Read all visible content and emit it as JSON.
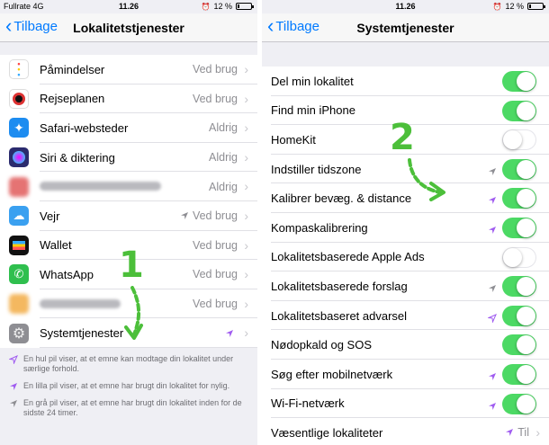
{
  "left": {
    "status": {
      "carrier": "Fullrate 4G",
      "time": "11.26",
      "battery": "12 %",
      "battery_level": 0.12
    },
    "nav": {
      "back": "Tilbage",
      "title": "Lokalitetstjenester"
    },
    "rows": [
      {
        "name": "reminders",
        "label": "Påmindelser",
        "value": "Ved brug",
        "icon": "reminders-icon",
        "color": "#ffffff"
      },
      {
        "name": "journey",
        "label": "Rejseplanen",
        "value": "Ved brug",
        "icon": "journey-planner-icon",
        "color": "#ffffff"
      },
      {
        "name": "safari",
        "label": "Safari-websteder",
        "value": "Aldrig",
        "icon": "safari-compass-icon",
        "color": "#1d8cf0"
      },
      {
        "name": "siri",
        "label": "Siri & diktering",
        "value": "Aldrig",
        "icon": "siri-icon",
        "color": "#2b2b6e"
      },
      {
        "name": "blurred-app",
        "label": "",
        "value": "Aldrig",
        "icon": "blurred-app-icon",
        "color": "#e57373"
      },
      {
        "name": "weather",
        "label": "Vejr",
        "value": "Ved brug",
        "icon": "weather-icon",
        "color": "#3aa0f0"
      },
      {
        "name": "wallet",
        "label": "Wallet",
        "value": "Ved brug",
        "icon": "wallet-icon",
        "color": "#111111"
      },
      {
        "name": "whatsapp",
        "label": "WhatsApp",
        "value": "Ved brug",
        "icon": "whatsapp-icon",
        "color": "#2fbf4e"
      },
      {
        "name": "blurred-app-2",
        "label": "",
        "value": "Ved brug",
        "icon": "blurred-app-icon",
        "color": "#f4b860"
      },
      {
        "name": "system-services",
        "label": "Systemtjenester",
        "value": "",
        "icon": "gear-icon",
        "color": "#8e8e93"
      }
    ],
    "footer": [
      "En hul pil viser, at et emne kan modtage din lokalitet under særlige forhold.",
      "En lilla pil viser, at et emne har brugt din lokalitet for nylig.",
      "En grå pil viser, at et emne har brugt din lokalitet inden for de sidste 24 timer."
    ],
    "annotation": "1"
  },
  "right": {
    "status": {
      "carrier": "",
      "time": "11.26",
      "battery": "12 %",
      "battery_level": 0.12
    },
    "nav": {
      "back": "Tilbage",
      "title": "Systemtjenester"
    },
    "rows": [
      {
        "label": "Del min lokalitet",
        "on": true,
        "arrow": ""
      },
      {
        "label": "Find min iPhone",
        "on": true,
        "arrow": ""
      },
      {
        "label": "HomeKit",
        "on": false,
        "arrow": ""
      },
      {
        "label": "Indstiller tidszone",
        "on": true,
        "arrow": "gray"
      },
      {
        "label": "Kalibrer bevæg. & distance",
        "on": true,
        "arrow": "purple"
      },
      {
        "label": "Kompaskalibrering",
        "on": true,
        "arrow": "purple"
      },
      {
        "label": "Lokalitetsbaserede Apple Ads",
        "on": false,
        "arrow": ""
      },
      {
        "label": "Lokalitetsbaserede forslag",
        "on": true,
        "arrow": "gray"
      },
      {
        "label": "Lokalitetsbaseret advarsel",
        "on": true,
        "arrow": "hollow"
      },
      {
        "label": "Nødopkald og SOS",
        "on": true,
        "arrow": ""
      },
      {
        "label": "Søg efter mobilnetværk",
        "on": true,
        "arrow": "purple"
      },
      {
        "label": "Wi-Fi-netværk",
        "on": true,
        "arrow": "purple"
      },
      {
        "label": "Væsentlige lokaliteter",
        "on": null,
        "arrow": "purple",
        "value": "Til"
      }
    ],
    "annotation": "2"
  },
  "colors": {
    "accent": "#007aff",
    "toggle_on": "#4cd964",
    "purple_arrow": "#a05cf0",
    "gray_arrow": "#8e8e93",
    "annotation": "#4cbf3a"
  }
}
